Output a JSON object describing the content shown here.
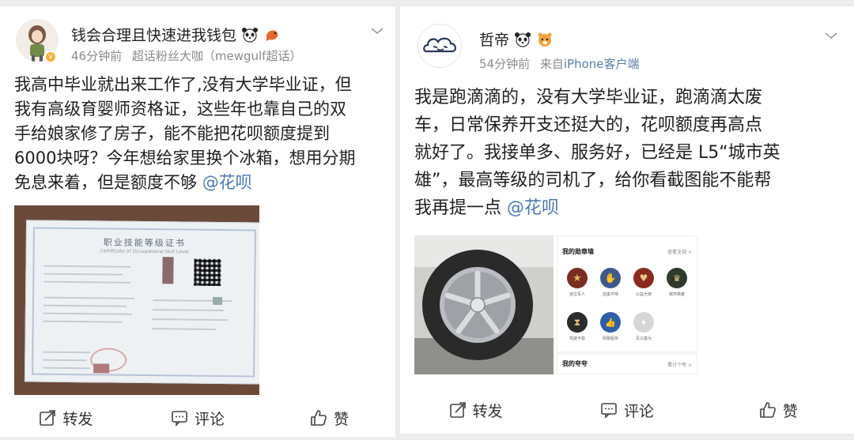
{
  "post_left": {
    "username": "钱会合理且快速进我钱包",
    "time": "46分钟前",
    "source": "超话粉丝大咖（mewgulf超话）",
    "body_lines": [
      "我高中毕业就出来工作了,没有大学毕业证，但",
      "我有高级育婴师资格证，这些年也靠自己的双",
      "手给娘家修了房子，能不能把花呗额度提到",
      "6000块呀？今年想给家里换个冰箱，想用分期",
      "免息来着，但是额度不够"
    ],
    "mention": "@花呗",
    "certificate": {
      "title": "职业技能等级证书",
      "subtitle": "Certificate of Occupational Skill Level"
    },
    "actions": {
      "repost": "转发",
      "comment": "评论",
      "like": "赞"
    }
  },
  "post_right": {
    "username": "哲帝",
    "time": "54分钟前",
    "source_prefix": "来自",
    "source": "iPhone客户端",
    "body_lines": [
      "我是跑滴滴的，没有大学毕业证，跑滴滴太废",
      "车，日常保养开支还挺大的，花呗额度再高点",
      "就好了。我接单多、服务好，已经是 L5“城市英",
      "雄”，最高等级的司机了，给你看截图能不能帮",
      "我再提一点"
    ],
    "mention": "@花呗",
    "medal_wall": {
      "title": "我的勋章墙",
      "view_all": "查看全部 >",
      "medals": [
        "进位军人",
        "拍金不味",
        "公益大使",
        "城市英雄",
        "驾驶平稳",
        "倾慕服务",
        "见义勇为"
      ],
      "footer_title": "我的夸夸",
      "footer_right": "累计个夸 >"
    },
    "actions": {
      "repost": "转发",
      "comment": "评论",
      "like": "赞"
    }
  },
  "colors": {
    "link": "#4a78b3",
    "meta": "#8b8b8b",
    "text": "#1f1f1f"
  }
}
